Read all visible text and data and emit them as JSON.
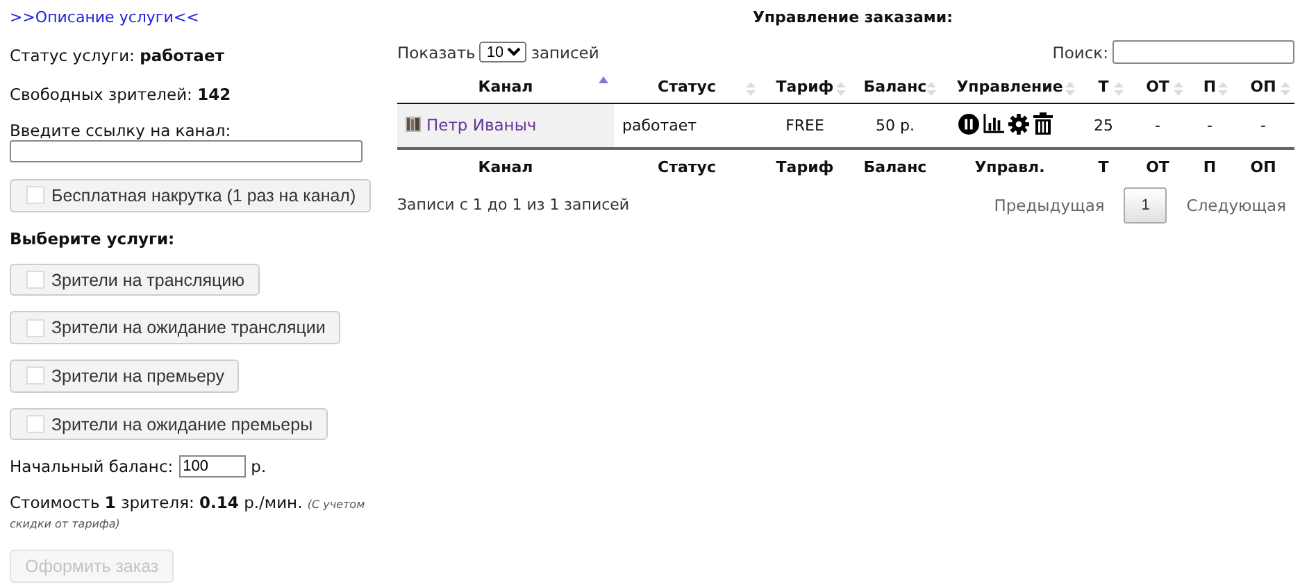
{
  "description_link": ">>Описание услуги<<",
  "status": {
    "label": "Статус услуги:",
    "value": "работает"
  },
  "free_viewers": {
    "label": "Свободных зрителей:",
    "value": "142"
  },
  "channel_field": {
    "label": "Введите ссылку на канал:"
  },
  "free_boost": {
    "label": "Бесплатная накрутка (1 раз на канал)",
    "checked": false
  },
  "services_heading": "Выберите услуги:",
  "services": [
    {
      "label": "Зрители на трансляцию",
      "checked": false
    },
    {
      "label": "Зрители на ожидание трансляции",
      "checked": false
    },
    {
      "label": "Зрители на премьеру",
      "checked": false
    },
    {
      "label": "Зрители на ожидание премьеры",
      "checked": false
    }
  ],
  "balance": {
    "label": "Начальный баланс:",
    "value": "100",
    "unit": "р."
  },
  "cost": "Стоимость **1** зрителя: **0.14** р./мин. *(С учетом скидки от тарифа)*",
  "submit": {
    "label": "Оформить заказ",
    "disabled": true
  },
  "orders_title": "Управление заказами:",
  "page_length": {
    "before": "Показать",
    "value": "10",
    "after": "записей"
  },
  "search": {
    "label": "Поиск:"
  },
  "columns": [
    {
      "label": "Канал",
      "sorted": true
    },
    {
      "label": "Статус",
      "sorted": false
    },
    {
      "label": "Тариф",
      "sorted": false
    },
    {
      "label": "Баланс",
      "sorted": false
    },
    {
      "label": "Управление",
      "sorted": false
    },
    {
      "label": "Т",
      "sorted": false
    },
    {
      "label": "ОТ",
      "sorted": false
    },
    {
      "label": "П",
      "sorted": false
    },
    {
      "label": "ОП",
      "sorted": false
    }
  ],
  "rows": [
    {
      "channel": "Петр Иваныч",
      "status": "работает",
      "tariff": "FREE",
      "balance": "50 р.",
      "t": "25",
      "ot": "-",
      "p": "-",
      "op": "-"
    }
  ],
  "footer_columns": [
    "Канал",
    "Статус",
    "Тариф",
    "Баланс",
    "Управл.",
    "Т",
    "ОТ",
    "П",
    "ОП"
  ],
  "info": "Записи с 1 до 1 из 1 записей",
  "pagination": {
    "previous": "Предыдущая",
    "pages": [
      {
        "label": "1",
        "selected": true
      }
    ],
    "next": "Следующая"
  }
}
